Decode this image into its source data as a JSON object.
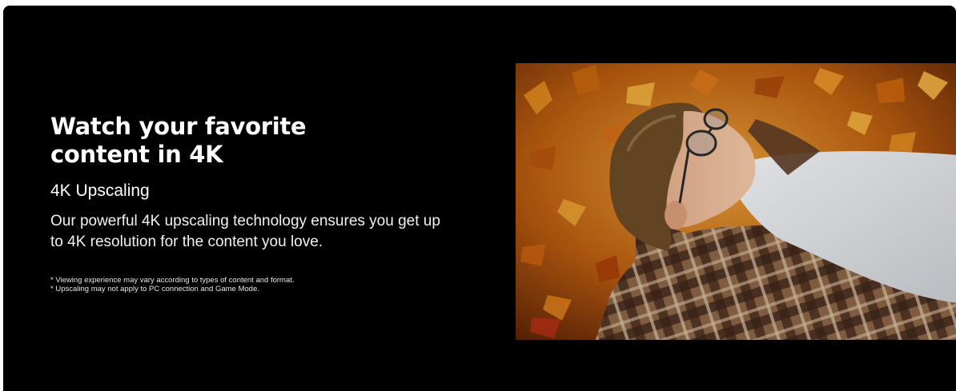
{
  "feature": {
    "headline": "Watch your favorite content in 4K",
    "subheading": "4K Upscaling",
    "description": "Our powerful 4K upscaling technology ensures you get up to 4K resolution for the content you love.",
    "footnotes": [
      "* Viewing experience may vary according to types of content and format.",
      "* Upscaling may not apply to PC connection and Game Mode."
    ]
  },
  "image": {
    "subject": "young man with glasses lying on autumn leaves",
    "colors": {
      "leaves": "#c56a12",
      "shirt": "#e9ecef",
      "jacket": "#7a5234",
      "hair": "#6b4a26"
    }
  }
}
